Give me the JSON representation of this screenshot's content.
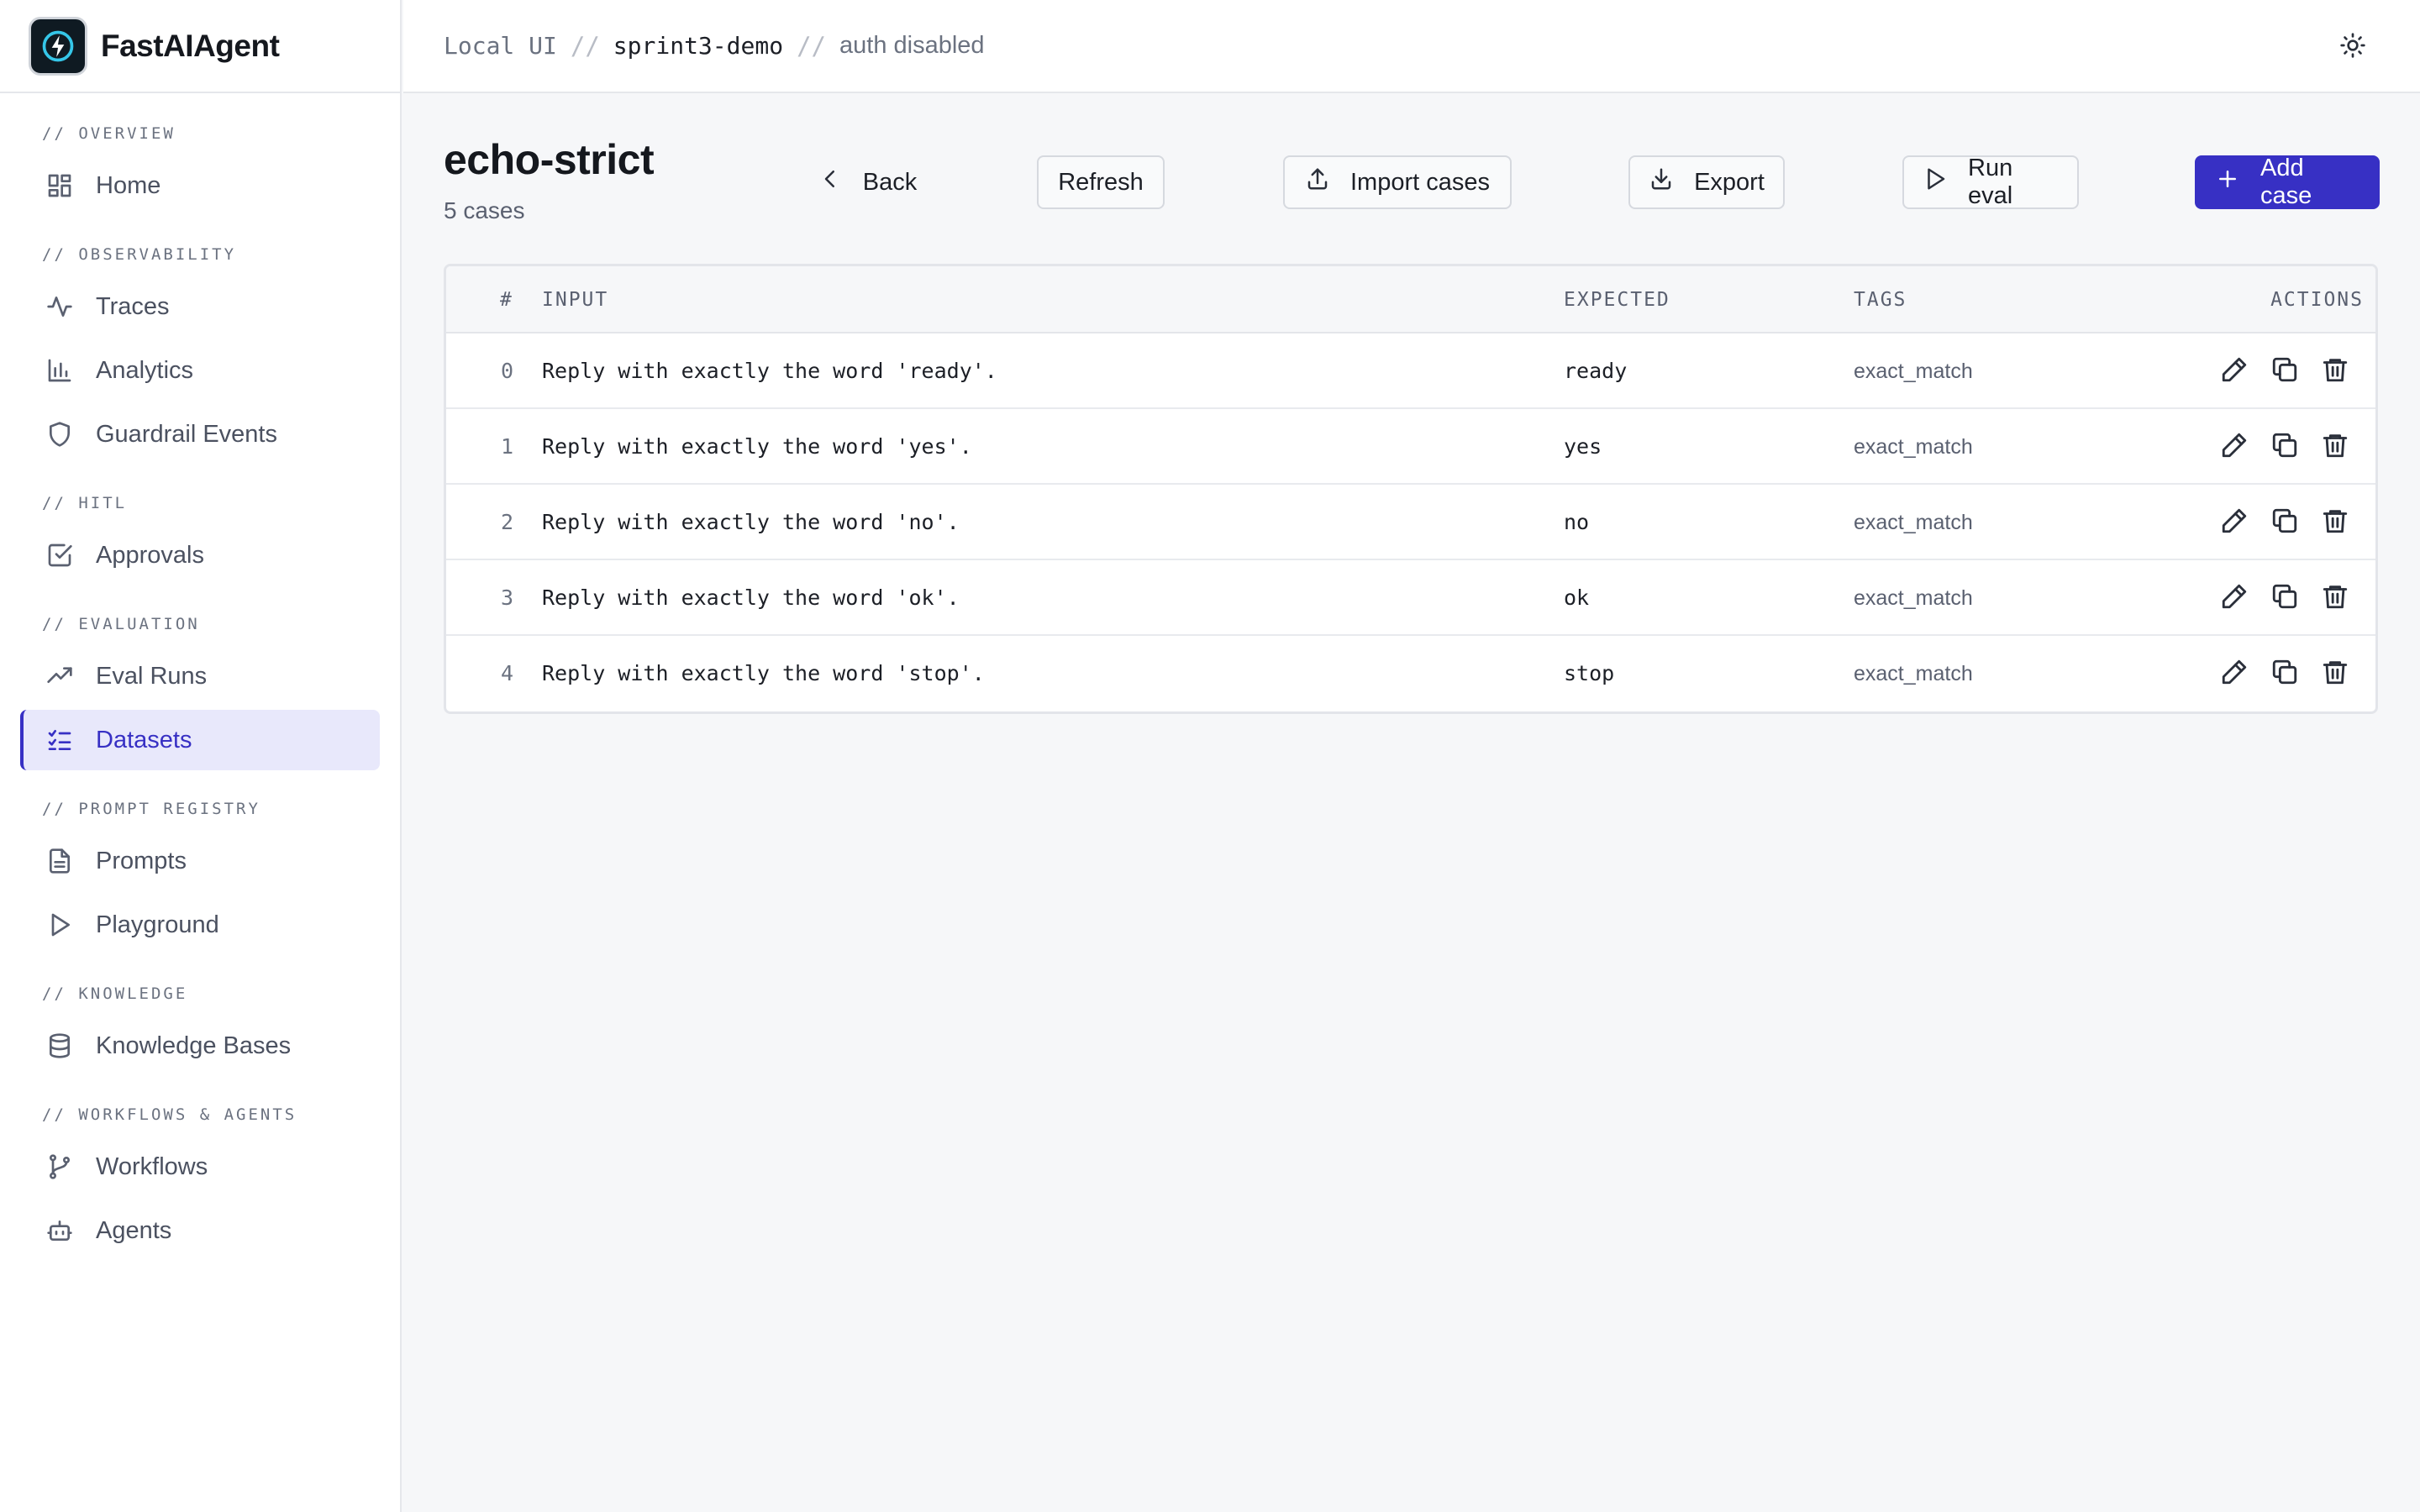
{
  "app": {
    "name": "FastAIAgent"
  },
  "breadcrumb": {
    "local": "Local UI",
    "sep": "//",
    "project": "sprint3-demo",
    "auth": "auth disabled"
  },
  "sidebar": {
    "sections": [
      {
        "label": "// OVERVIEW",
        "items": [
          {
            "label": "Home",
            "icon": "grid-icon"
          }
        ]
      },
      {
        "label": "// OBSERVABILITY",
        "items": [
          {
            "label": "Traces",
            "icon": "activity-icon"
          },
          {
            "label": "Analytics",
            "icon": "bar-chart-icon"
          },
          {
            "label": "Guardrail Events",
            "icon": "shield-icon"
          }
        ]
      },
      {
        "label": "// HITL",
        "items": [
          {
            "label": "Approvals",
            "icon": "check-square-icon"
          }
        ]
      },
      {
        "label": "// EVALUATION",
        "items": [
          {
            "label": "Eval Runs",
            "icon": "trending-up-icon"
          },
          {
            "label": "Datasets",
            "icon": "list-checks-icon",
            "active": true
          }
        ]
      },
      {
        "label": "// PROMPT REGISTRY",
        "items": [
          {
            "label": "Prompts",
            "icon": "file-text-icon"
          },
          {
            "label": "Playground",
            "icon": "play-icon"
          }
        ]
      },
      {
        "label": "// KNOWLEDGE",
        "items": [
          {
            "label": "Knowledge Bases",
            "icon": "database-icon"
          }
        ]
      },
      {
        "label": "// WORKFLOWS & AGENTS",
        "items": [
          {
            "label": "Workflows",
            "icon": "git-branch-icon"
          },
          {
            "label": "Agents",
            "icon": "bot-icon"
          }
        ]
      }
    ]
  },
  "page": {
    "title": "echo-strict",
    "subtitle": "5 cases"
  },
  "toolbar": {
    "back": "Back",
    "refresh": "Refresh",
    "import": "Import cases",
    "export": "Export",
    "run_eval": "Run eval",
    "add_case": "Add case"
  },
  "table": {
    "headers": {
      "index": "#",
      "input": "INPUT",
      "expected": "EXPECTED",
      "tags": "TAGS",
      "actions": "ACTIONS"
    },
    "rows": [
      {
        "index": "0",
        "input": "Reply with exactly the word 'ready'.",
        "expected": "ready",
        "tags": "exact_match"
      },
      {
        "index": "1",
        "input": "Reply with exactly the word 'yes'.",
        "expected": "yes",
        "tags": "exact_match"
      },
      {
        "index": "2",
        "input": "Reply with exactly the word 'no'.",
        "expected": "no",
        "tags": "exact_match"
      },
      {
        "index": "3",
        "input": "Reply with exactly the word 'ok'.",
        "expected": "ok",
        "tags": "exact_match"
      },
      {
        "index": "4",
        "input": "Reply with exactly the word 'stop'.",
        "expected": "stop",
        "tags": "exact_match"
      }
    ]
  },
  "colors": {
    "accent": "#3730c4",
    "active_bg": "#e8e8fb",
    "background": "#f6f7f9"
  }
}
